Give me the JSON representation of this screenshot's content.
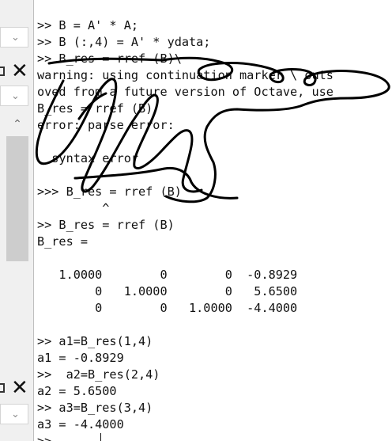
{
  "console_lines": [
    ">> B = A' * A;",
    ">> B (:,4) = A' * ydata;",
    ">> B_res = rref (B)\\",
    "warning: using continuation marker \\ outs",
    "oved from a future version of Octave, use",
    "B_res = rref (B)",
    "error: parse error:",
    "",
    "  syntax error",
    "",
    ">>> B_res = rref (B)",
    "         ^",
    "",
    ">> B_res = rref (B)",
    "B_res =",
    "",
    "   1.0000        0        0  -0.8929",
    "        0   1.0000        0   5.6500",
    "        0        0   1.0000  -4.4000",
    "",
    ">> a1=B_res(1,4)",
    "a1 = -0.8929",
    ">>  a2=B_res(2,4)",
    "a2 = 5.6500",
    ">> a3=B_res(3,4)",
    "a3 = -4.4000",
    ">> "
  ],
  "sidebar": {
    "close_glyph": "✕",
    "dropdown_glyph": "⌄",
    "scroll_up_glyph": "⌃"
  }
}
